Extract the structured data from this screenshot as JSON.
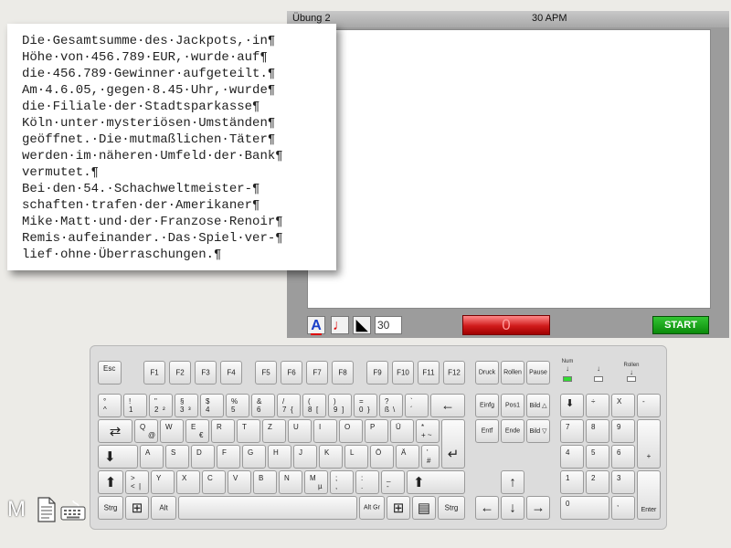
{
  "panel": {
    "exercise_title": "Übung 2",
    "timer": "30 APM",
    "toolbar": {
      "font_button": "A",
      "note_button": "♩",
      "cursor_button": "◣",
      "count_value": "30",
      "error_count": "0",
      "start_label": "START"
    }
  },
  "text": {
    "lines": [
      "Die·Gesamtsumme·des·Jackpots,·in¶",
      "Höhe·von·456.789·EUR,·wurde·auf¶",
      "die·456.789·Gewinner·aufgeteilt.¶",
      "Am·4.6.05,·gegen·8.45·Uhr,·wurde¶",
      "die·Filiale·der·Stadtsparkasse¶",
      "Köln·unter·mysteriösen·Umständen¶",
      "geöffnet.·Die·mutmaßlichen·Täter¶",
      "werden·im·näheren·Umfeld·der·Bank¶",
      "vermutet.¶",
      "Bei·den·54.·Schachweltmeister-¶",
      "schaften·trafen·der·Amerikaner¶",
      "Mike·Matt·und·der·Franzose·Renoir¶",
      "Remis·aufeinander.·Das·Spiel·ver-¶",
      "lief·ohne·Überraschungen.¶"
    ]
  },
  "keyboard": {
    "row_f": [
      "Esc",
      "F1",
      "F2",
      "F3",
      "F4",
      "F5",
      "F6",
      "F7",
      "F8",
      "F9",
      "F10",
      "F11",
      "F12"
    ],
    "special": {
      "druck": "Druck",
      "rollen": "Rollen",
      "pause": "Pause"
    },
    "indicators": {
      "num": "Num",
      "caps": "",
      "scroll": "Rollen"
    },
    "num_row": [
      {
        "t": "°",
        "b": "^"
      },
      {
        "t": "!",
        "b": "1"
      },
      {
        "t": "\"",
        "b": "2"
      },
      {
        "t": "§",
        "b": "3"
      },
      {
        "t": "$",
        "b": "4"
      },
      {
        "t": "%",
        "b": "5"
      },
      {
        "t": "&",
        "b": "6"
      },
      {
        "t": "/",
        "b": "7"
      },
      {
        "t": "(",
        "b": "8"
      },
      {
        "t": ")",
        "b": "9"
      },
      {
        "t": "=",
        "b": "0"
      },
      {
        "t": "?",
        "b": "ß"
      },
      {
        "t": "`",
        "b": "´"
      }
    ],
    "num_row_alt": [
      "",
      "",
      "²",
      "³",
      "",
      "",
      "",
      "{",
      "[",
      "]",
      "}",
      "\\",
      ""
    ],
    "q_row": [
      "Q",
      "W",
      "E",
      "R",
      "T",
      "Z",
      "U",
      "I",
      "O",
      "P",
      "Ü"
    ],
    "q_row_extra": {
      "t": "*",
      "b": "+ ~"
    },
    "q_alt": {
      "q": "@",
      "e": "€"
    },
    "a_row": [
      "A",
      "S",
      "D",
      "F",
      "G",
      "H",
      "J",
      "K",
      "L",
      "Ö",
      "Ä"
    ],
    "a_row_extra": {
      "t": "'",
      "b": "#"
    },
    "y_row": [
      "Y",
      "X",
      "C",
      "V",
      "B",
      "N",
      "M"
    ],
    "y_punct": [
      {
        "t": ";",
        "b": ","
      },
      {
        "t": ":",
        "b": "."
      },
      {
        "t": "_",
        "b": "-"
      }
    ],
    "y_left": {
      "t": ">",
      "b": "<",
      "alt": "|"
    },
    "m_alt": "µ",
    "bottom": {
      "strg_left": "Strg",
      "alt": "Alt",
      "altgr": "Alt Gr",
      "strg_right": "Strg"
    },
    "nav": {
      "einfg": "Einfg",
      "pos1": "Pos1",
      "bild_up": "Bild △",
      "entf": "Entf",
      "ende": "Ende",
      "bild_down": "Bild ▽"
    },
    "numpad": {
      "row1": [
        "÷",
        "X",
        "-"
      ],
      "row2": [
        "7",
        "8",
        "9"
      ],
      "row3": [
        "4",
        "5",
        "6"
      ],
      "row4": [
        "1",
        "2",
        "3"
      ],
      "plus": "+",
      "zero": "0",
      "comma": ",",
      "enter": "Enter"
    }
  },
  "footer": {
    "mode_letter": "M"
  }
}
